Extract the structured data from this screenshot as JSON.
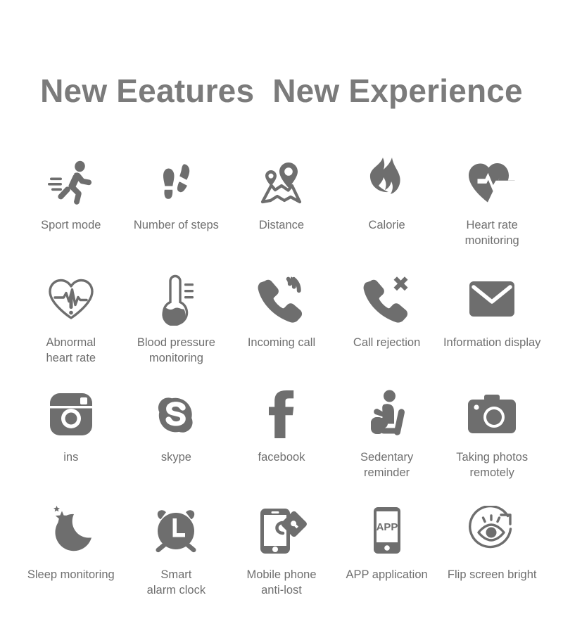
{
  "header": {
    "title": "New Eeatures  New Experience",
    "title_color": "#7b7b7b"
  },
  "theme": {
    "background": "#ffffff",
    "icon_color": "#6e6e6e",
    "label_color": "#6f6f6f"
  },
  "features": [
    {
      "icon": "running-person-icon",
      "label": "Sport mode"
    },
    {
      "icon": "footsteps-icon",
      "label": "Number of steps"
    },
    {
      "icon": "map-pins-route-icon",
      "label": "Distance"
    },
    {
      "icon": "flame-icon",
      "label": "Calorie"
    },
    {
      "icon": "heart-pulse-icon",
      "label": "Heart rate\nmonitoring"
    },
    {
      "icon": "heart-outline-ecg-alert-icon",
      "label": "Abnormal\nheart rate"
    },
    {
      "icon": "thermometer-icon",
      "label": "Blood pressure\nmonitoring"
    },
    {
      "icon": "phone-incoming-call-icon",
      "label": "Incoming call"
    },
    {
      "icon": "phone-call-reject-icon",
      "label": "Call rejection"
    },
    {
      "icon": "envelope-icon",
      "label": "Information display"
    },
    {
      "icon": "instagram-camera-icon",
      "label": "ins"
    },
    {
      "icon": "skype-icon",
      "label": "skype"
    },
    {
      "icon": "facebook-icon",
      "label": "facebook"
    },
    {
      "icon": "seated-person-icon",
      "label": "Sedentary\nreminder"
    },
    {
      "icon": "camera-icon",
      "label": "Taking photos\nremotely"
    },
    {
      "icon": "moon-stars-icon",
      "label": "Sleep monitoring"
    },
    {
      "icon": "alarm-clock-icon",
      "label": "Smart\nalarm clock"
    },
    {
      "icon": "phone-lock-icon",
      "label": "Mobile phone\nanti-lost"
    },
    {
      "icon": "app-phone-icon",
      "label": "APP application",
      "icon_text": "APP"
    },
    {
      "icon": "eye-rotate-icon",
      "label": "Flip screen bright"
    }
  ]
}
